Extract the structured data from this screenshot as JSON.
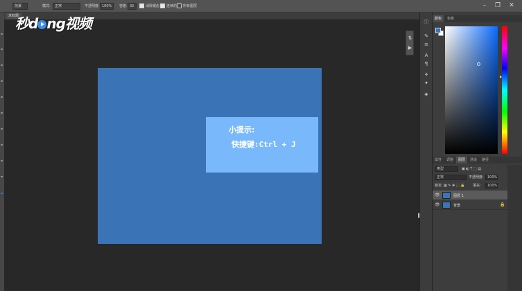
{
  "options_bar": {
    "tool_preset": "前景",
    "mode_label": "模式:",
    "mode_value": "正常",
    "opacity_label": "不透明度:",
    "opacity_value": "100%",
    "tolerance_label": "容差:",
    "tolerance_value": "32",
    "checkboxes": [
      {
        "label": "消除锯齿",
        "checked": true
      },
      {
        "label": "连续的",
        "checked": true
      },
      {
        "label": "所有图层",
        "checked": false
      }
    ]
  },
  "document_tab": {
    "title": "未标题"
  },
  "watermark": {
    "pre": "秒d",
    "post": "ng视频"
  },
  "canvas": {
    "background_color": "#3b74b6",
    "tip_color": "#79b9fb",
    "tip_title": "小提示:",
    "tip_shortcut": "快捷键:Ctrl + J"
  },
  "color_panel": {
    "tabs": [
      "颜色",
      "色板"
    ],
    "foreground": "#3b74b6",
    "background": "#ffffff"
  },
  "layers_panel": {
    "tabs": [
      "属性",
      "调整",
      "图层",
      "通道",
      "路径"
    ],
    "active_tab": "图层",
    "filter_kind": "类型",
    "blend_mode": "正常",
    "opacity_label": "不透明度:",
    "opacity_value": "100%",
    "lock_label": "锁定:",
    "fill_label": "填充:",
    "fill_value": "100%",
    "layers": [
      {
        "name": "图层 1",
        "selected": true,
        "locked": false
      },
      {
        "name": "背景",
        "selected": false,
        "locked": true
      }
    ]
  },
  "icons": [
    "eye-icon",
    "lock-icon",
    "cursor-icon",
    "play-icon",
    "info-icon"
  ]
}
